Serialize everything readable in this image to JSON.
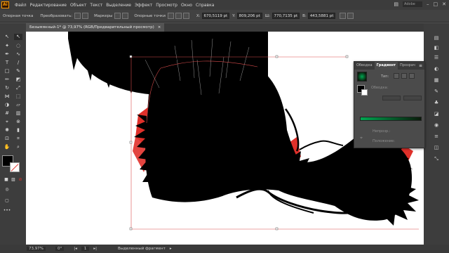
{
  "menu": {
    "logo": "Ai",
    "items": [
      "Файл",
      "Редактирование",
      "Объект",
      "Текст",
      "Выделение",
      "Эффект",
      "Просмотр",
      "Окно",
      "Справка"
    ],
    "search_placeholder": "Adobe"
  },
  "control_bar": {
    "mode": "Опорная точка",
    "convert_label": "Преобразовать:",
    "markers_label": "Маркеры",
    "anchors_label": "Опорные точки",
    "x": "670,5119 pt",
    "y": "809,206 pt",
    "w": "770,7135 pt",
    "h": "443,5881 pt"
  },
  "document": {
    "tab_title": "Безымянный-1* @ 73,97% (RGB/Предварительный просмотр)",
    "close": "×"
  },
  "panel": {
    "tabs": [
      "Обводка",
      "Градиент",
      "Прозрач"
    ],
    "type_label": "Тип:",
    "stroke_label": "Обводка:",
    "opacity_label": "Непрозр.:",
    "location_label": "Положение:",
    "gradient_start": "#00a651",
    "gradient_end": "#0a1a0a"
  },
  "status": {
    "zoom": "73,97%",
    "rotation": "0°",
    "page": "1",
    "selection": "Выделенный фрагмент"
  },
  "colors": {
    "artwork": "#000000",
    "stroke_guide": "#d94c4c",
    "accent_red": "#e0302a"
  }
}
